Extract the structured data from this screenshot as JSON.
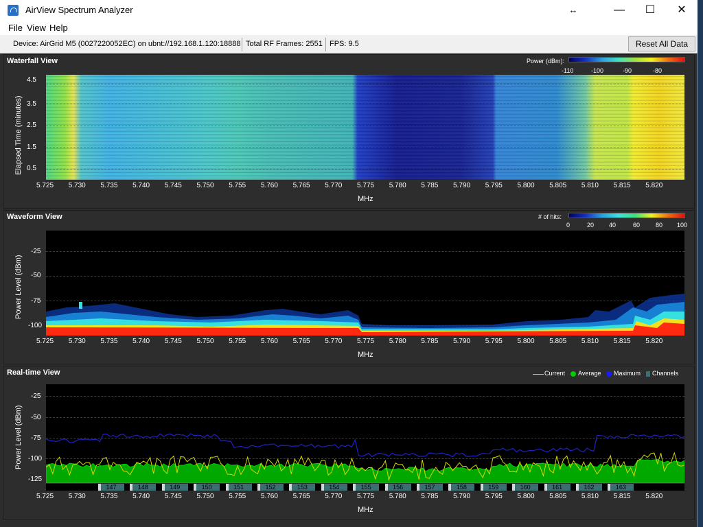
{
  "window": {
    "title": "AirView Spectrum Analyzer",
    "minimize": "—",
    "maximize": "☐",
    "close": "✕",
    "resize_cursor": "↔"
  },
  "menu": [
    "File",
    "View",
    "Help"
  ],
  "toolbar": {
    "device": "Device: AirGrid M5 (0027220052EC) on ubnt://192.168.1.120:18888",
    "frames": "Total RF Frames: 2551",
    "fps": "FPS: 9.5",
    "reset_label": "Reset All Data"
  },
  "x_axis": {
    "label": "MHz",
    "ticks": [
      "5.725",
      "5.730",
      "5.735",
      "5.740",
      "5.745",
      "5.750",
      "5.755",
      "5.760",
      "5.765",
      "5.770",
      "5.775",
      "5.780",
      "5.785",
      "5.790",
      "5.795",
      "5.800",
      "5.805",
      "5.810",
      "5.815",
      "5.820"
    ]
  },
  "waterfall": {
    "title": "Waterfall View",
    "ylabel": "Elapsed Time (minutes)",
    "yticks": [
      "4.5",
      "3.5",
      "2.5",
      "1.5",
      "0.5"
    ],
    "scale_label": "Power (dBm):",
    "scale_ticks": [
      "-110",
      "-100",
      "-90",
      "-80"
    ]
  },
  "waveform": {
    "title": "Waveform View",
    "ylabel": "Power Level (dBm)",
    "yticks": [
      "-25",
      "-50",
      "-75",
      "-100"
    ],
    "scale_label": "# of hits:",
    "scale_ticks": [
      "0",
      "20",
      "40",
      "60",
      "80",
      "100"
    ]
  },
  "realtime": {
    "title": "Real-time View",
    "ylabel": "Power Level (dBm)",
    "yticks": [
      "-25",
      "-50",
      "-75",
      "-100",
      "-125"
    ],
    "legend": [
      "Current",
      "Average",
      "Maximum",
      "Channels"
    ],
    "legend_colors": {
      "Current": "#d8d800",
      "Average": "#00cc00",
      "Maximum": "#1a1aff",
      "Channels": "#3b6e73"
    },
    "channels": [
      "147",
      "148",
      "149",
      "150",
      "151",
      "152",
      "153",
      "154",
      "155",
      "156",
      "157",
      "158",
      "159",
      "160",
      "161",
      "162",
      "163"
    ]
  }
}
